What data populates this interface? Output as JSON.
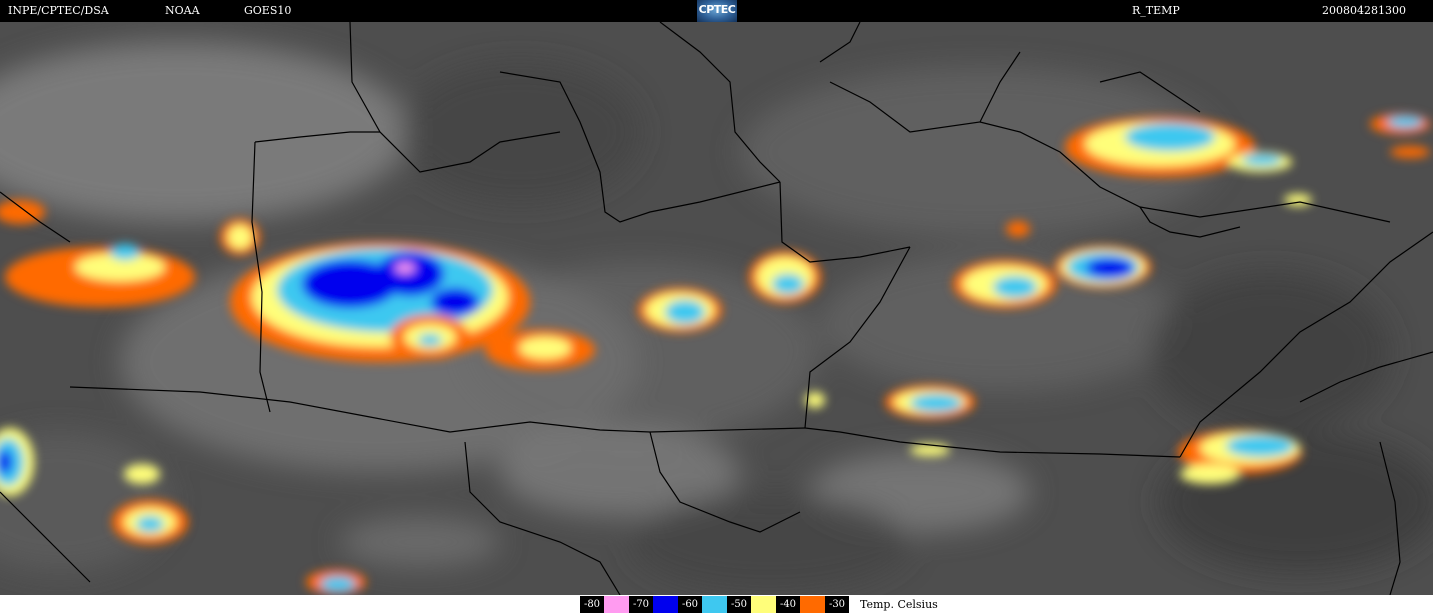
{
  "header": {
    "source_left": "INPE/CPTEC/DSA",
    "agency": "NOAA",
    "satellite": "GOES10",
    "logo_text": "CPTEC",
    "product": "R_TEMP",
    "timestamp": "200804281300"
  },
  "legend": {
    "items": [
      {
        "label": "-80",
        "color": "#ff9bf0"
      },
      {
        "label": "-70",
        "color": "#0000ee"
      },
      {
        "label": "-60",
        "color": "#3ec8f0"
      },
      {
        "label": "-50",
        "color": "#fffe7a"
      },
      {
        "label": "-40",
        "color": "#ff6a00"
      },
      {
        "label": "-30"
      }
    ],
    "unit": "Temp. Celsius"
  },
  "colors": {
    "cloud_background": "#575757",
    "borders": "#000000"
  }
}
